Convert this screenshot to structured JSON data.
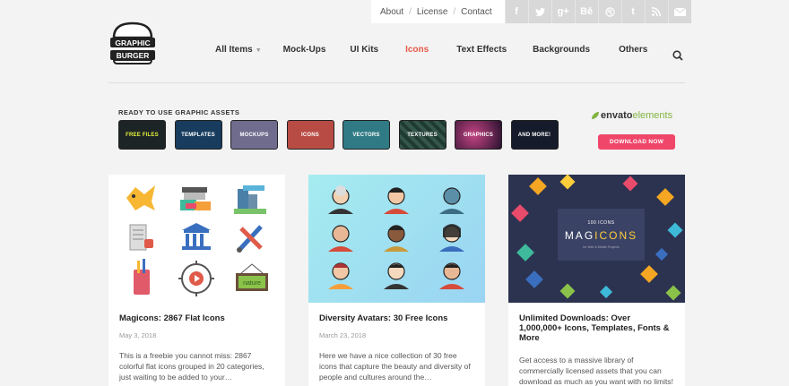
{
  "topbar": {
    "links": [
      "About",
      "License",
      "Contact"
    ],
    "socials": [
      "f",
      "twitter",
      "g+",
      "Bē",
      "dribbble",
      "t",
      "rss",
      "mail"
    ]
  },
  "logo": {
    "line1": "GRAPHIC",
    "line2": "BURGER"
  },
  "nav": {
    "items": [
      "All Items",
      "Mock-Ups",
      "UI Kits",
      "Icons",
      "Text Effects",
      "Backgrounds",
      "Others"
    ],
    "active": "Icons"
  },
  "promo": {
    "title": "READY TO USE GRAPHIC ASSETS",
    "tiles": [
      "FREE FILES",
      "TEMPLATES",
      "MOCKUPS",
      "ICONS",
      "VECTORS",
      "TEXTURES",
      "GRAPHICS",
      "AND MORE!"
    ],
    "envato_prefix": "envato",
    "envato_suffix": "elements",
    "download": "DOWNLOAD NOW"
  },
  "cards": [
    {
      "title": "Magicons: 2867 Flat Icons",
      "date": "May 3, 2018",
      "excerpt": "This is a freebie you cannot miss: 2867 colorful flat icons grouped in 20 categories, just waiting to be added to your…",
      "thumb_text": "nature"
    },
    {
      "title": "Diversity Avatars: 30 Free Icons",
      "date": "March 23, 2018",
      "excerpt": "Here we have a nice collection of 30 free icons that capture the beauty and diversity of people and cultures around the…"
    },
    {
      "title": "Unlimited Downloads: Over 1,000,000+ Icons, Templates, Fonts & More",
      "date": "",
      "excerpt": "Get access to a massive library of commercially licensed assets that you can download as much as you want with no limits!",
      "thumb_small": "100 ICONS",
      "thumb_big_a": "MAG",
      "thumb_big_b": "ICONS",
      "thumb_tag": "for Web & Mobile Projects"
    }
  ],
  "colors": {
    "accent": "#e65a4a",
    "envato_green": "#82b541",
    "button": "#f0466a"
  }
}
